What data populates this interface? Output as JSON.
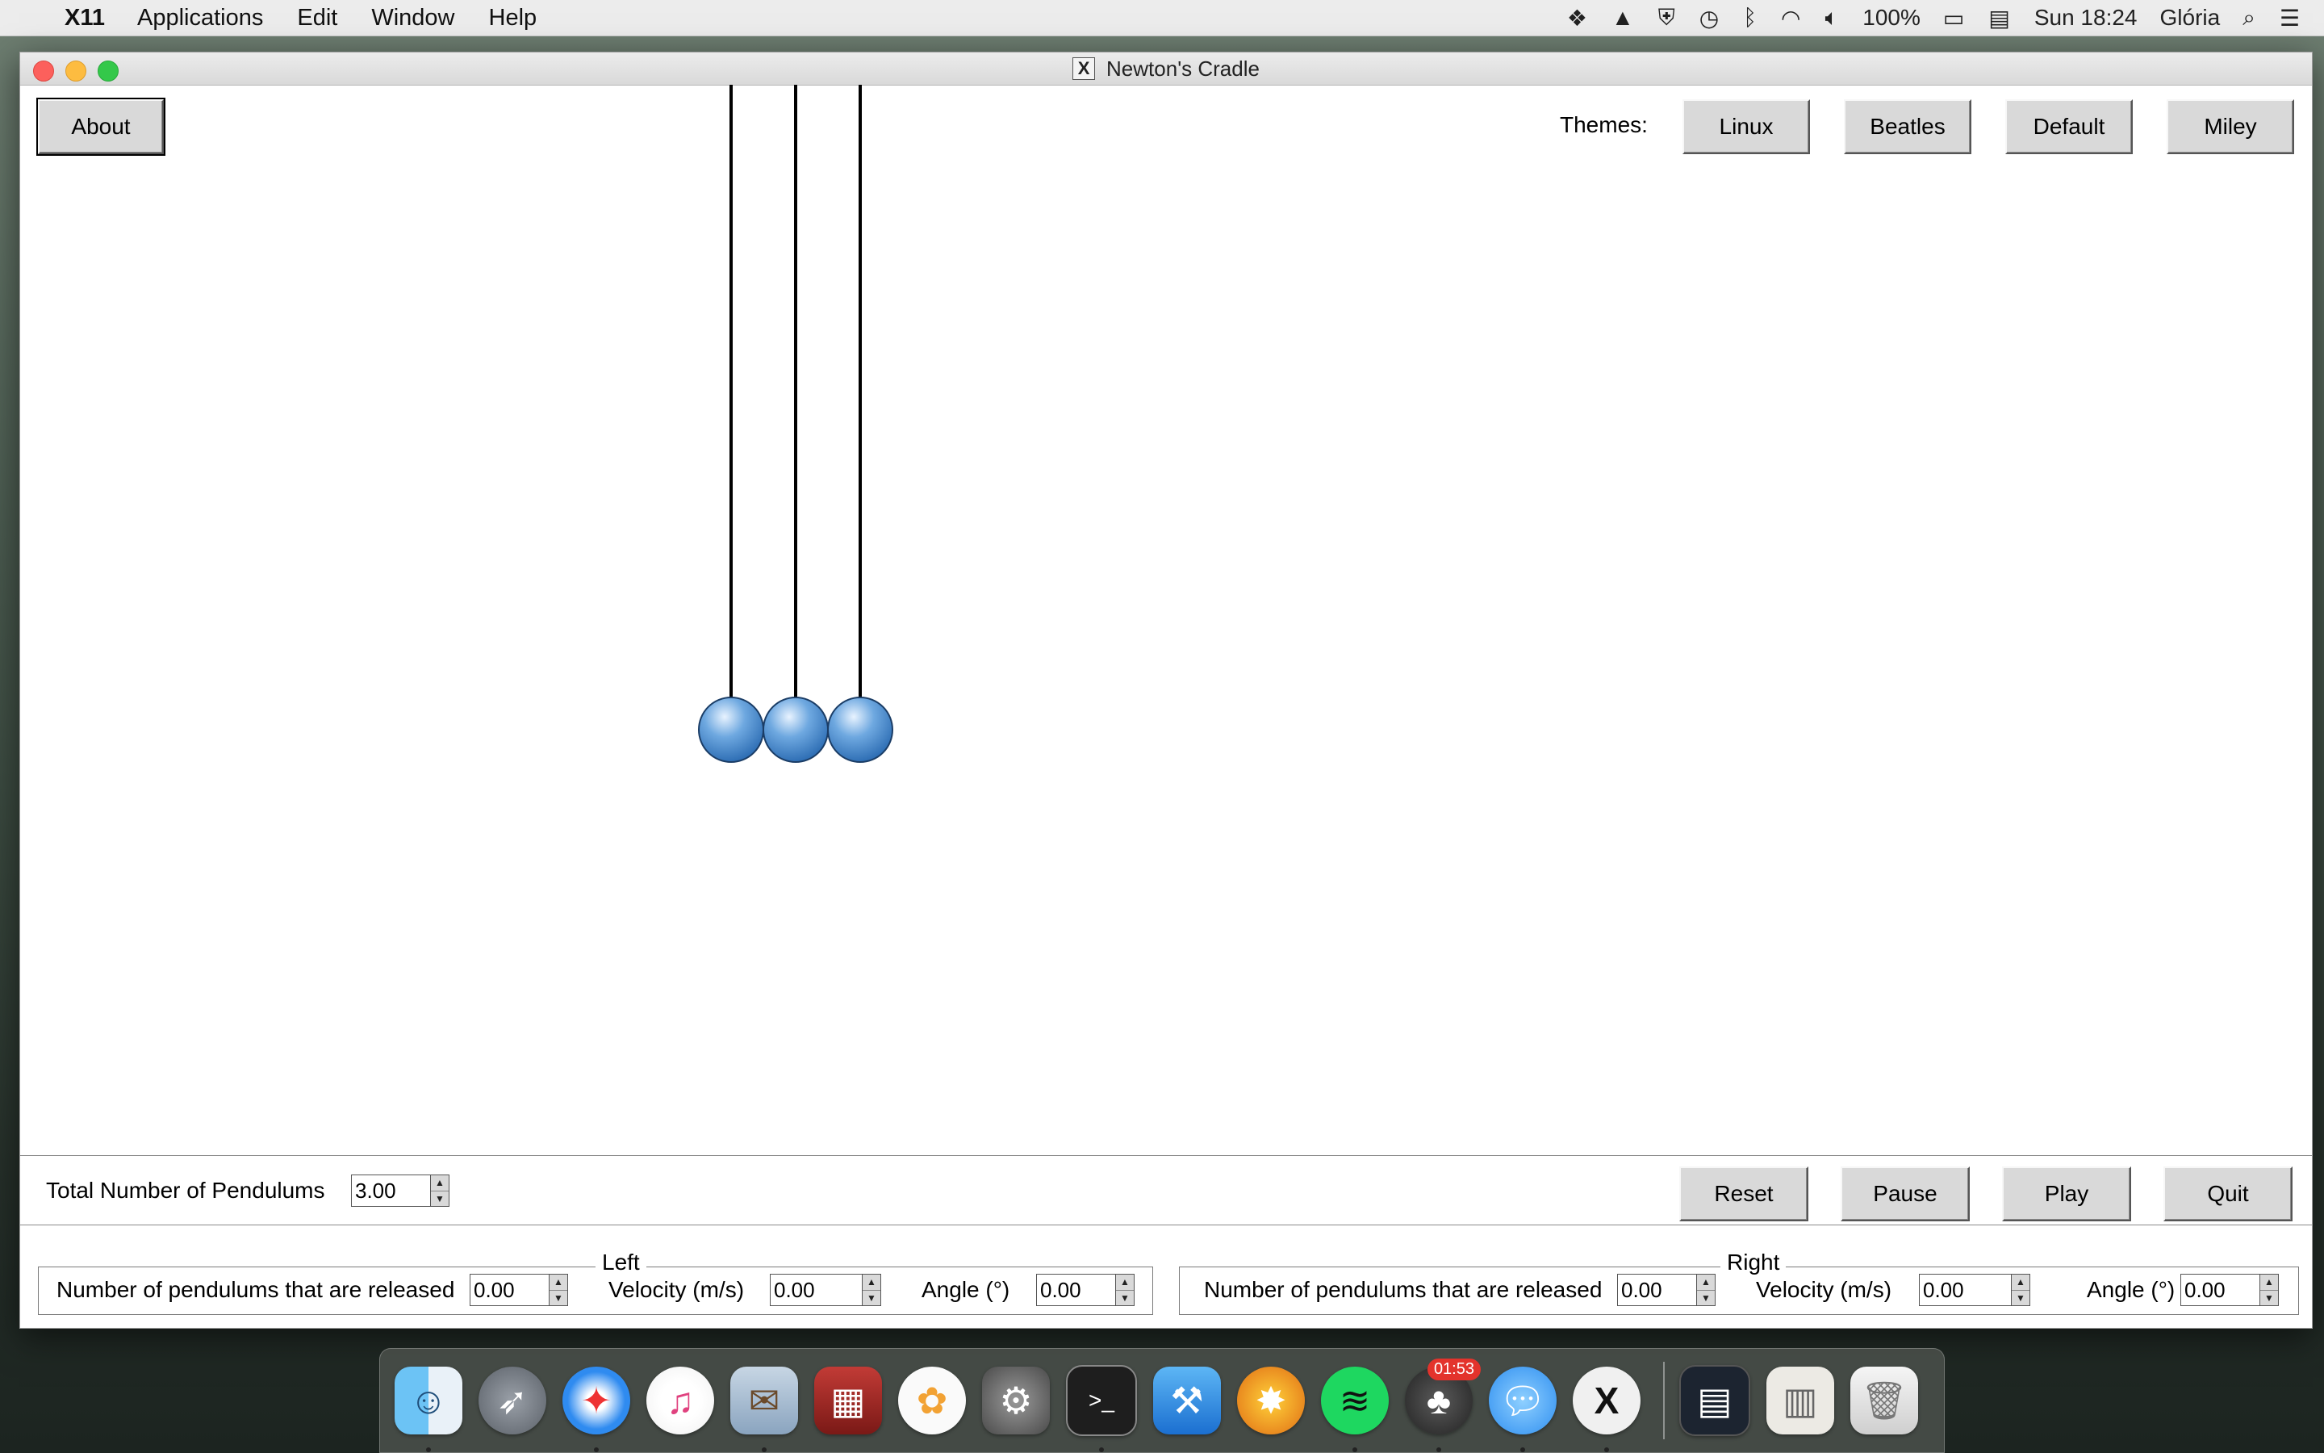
{
  "menubar": {
    "app_name": "X11",
    "items": [
      "Applications",
      "Edit",
      "Window",
      "Help"
    ],
    "battery": "100%",
    "clock": "Sun 18:24",
    "user": "Glória"
  },
  "window": {
    "title": "Newton's Cradle",
    "about_label": "About",
    "themes_label": "Themes:",
    "themes": [
      "Linux",
      "Beatles",
      "Default",
      "Miley"
    ]
  },
  "cradle": {
    "pendulum_count": 3,
    "ball_color": "#6ea8e0"
  },
  "controls": {
    "total_label": "Total Number of Pendulums",
    "total_value": "3.00",
    "reset_label": "Reset",
    "pause_label": "Pause",
    "play_label": "Play",
    "quit_label": "Quit"
  },
  "left": {
    "title": "Left",
    "released_label": "Number of pendulums that are released",
    "released_value": "0.00",
    "velocity_label": "Velocity (m/s)",
    "velocity_value": "0.00",
    "angle_label": "Angle (°)",
    "angle_value": "0.00"
  },
  "right": {
    "title": "Right",
    "released_label": "Number of pendulums that are released",
    "released_value": "0.00",
    "velocity_label": "Velocity (m/s)",
    "velocity_value": "0.00",
    "angle_label": "Angle (°)",
    "angle_value": "0.00"
  },
  "dock": {
    "badge": "01:53"
  }
}
